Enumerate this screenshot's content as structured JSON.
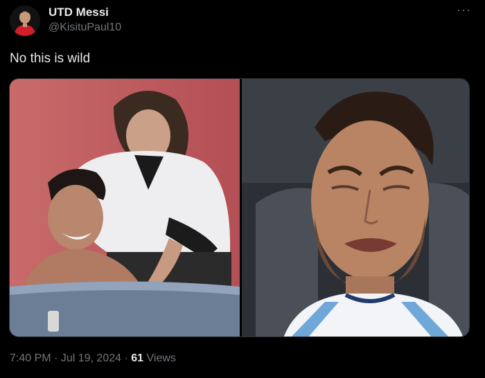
{
  "author": {
    "display_name": "UTD Messi",
    "handle": "@KisituPaul10"
  },
  "tweet": {
    "text": "No this is wild",
    "more_icon": "more-icon"
  },
  "media": {
    "left_image": "tub-photo",
    "right_image": "crying-player-photo"
  },
  "meta": {
    "time": "7:40 PM",
    "separator": "·",
    "date": "Jul 19, 2024",
    "views_count": "61",
    "views_label": "Views"
  }
}
